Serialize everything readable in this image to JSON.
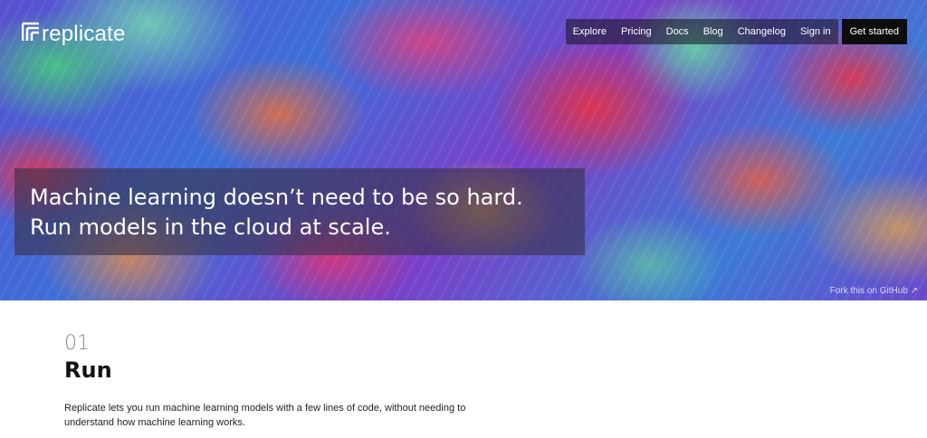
{
  "brand": {
    "name": "replicate"
  },
  "nav": {
    "items": [
      "Explore",
      "Pricing",
      "Docs",
      "Blog",
      "Changelog",
      "Sign in"
    ],
    "cta": "Get started"
  },
  "hero": {
    "headline_line1": "Machine learning doesn’t need to be so hard.",
    "headline_line2": "Run models in the cloud at scale.",
    "github_link": "Fork this on GitHub ↗"
  },
  "section": {
    "number": "01",
    "title": "Run",
    "description": "Replicate lets you run machine learning models with a few lines of code, without needing to understand how machine learning works."
  },
  "colors": {
    "cta_bg": "#0d0d0d",
    "text": "#111111",
    "muted": "#8a8a8a"
  }
}
